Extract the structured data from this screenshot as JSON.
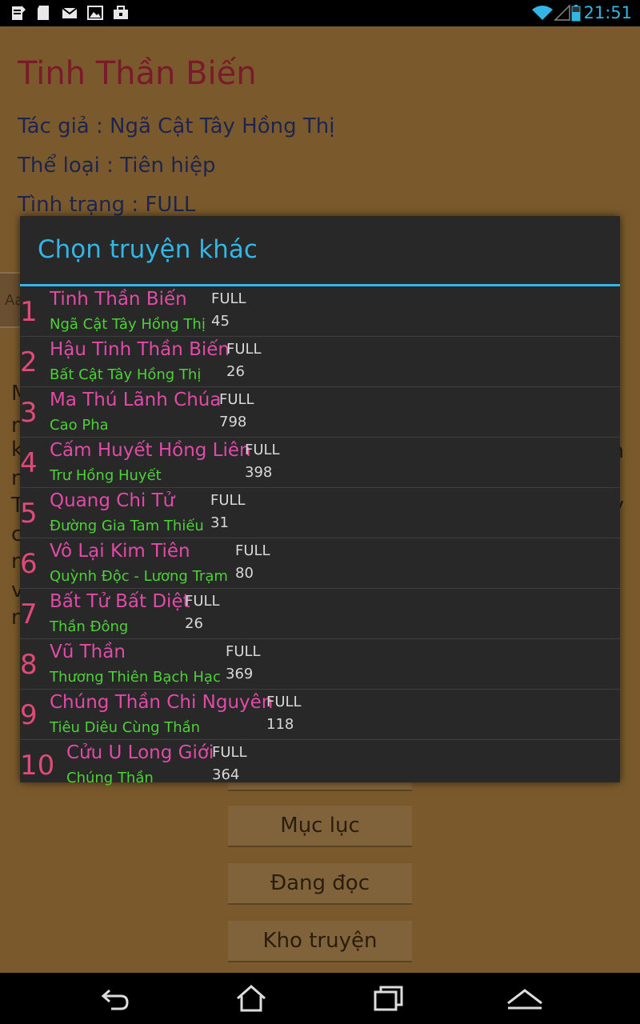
{
  "status_bar": {
    "time": "21:51",
    "icons": [
      "notes-icon",
      "sd-card-icon",
      "mail-icon",
      "image-icon",
      "briefcase-icon",
      "wifi-icon",
      "signal-icon",
      "battery-icon"
    ]
  },
  "book": {
    "title": "Tinh Thần Biến",
    "author": "Tác giả : Ngã Cật Tây Hồng Thị",
    "genre": "Thể loại : Tiên hiệp",
    "status": "Tình trạng : FULL"
  },
  "background_fragments": [
    "M",
    "n",
    "k",
    "n",
    "T",
    "c",
    "n",
    "v",
    "n"
  ],
  "background_fragments_right": [
    "n",
    "y"
  ],
  "side_badge": "Aa",
  "buttons": {
    "table_of_contents": "Mục lục",
    "reading": "Đang đọc",
    "library": "Kho truyện"
  },
  "dialog": {
    "title": "Chọn truyện khác",
    "items": [
      {
        "num": "1",
        "title": "Tinh Thần Biến",
        "author": "Ngã Cật Tây Hồng Thị",
        "status": "FULL",
        "chapters": "45"
      },
      {
        "num": "2",
        "title": "Hậu Tinh Thần Biến",
        "author": "Bất Cật Tây Hồng Thị",
        "status": "FULL",
        "chapters": "26"
      },
      {
        "num": "3",
        "title": "Ma Thú Lãnh Chúa",
        "author": "Cao Pha",
        "status": "FULL",
        "chapters": "798"
      },
      {
        "num": "4",
        "title": "Cấm Huyết Hồng Liên",
        "author": "Trư Hồng Huyết",
        "status": "FULL",
        "chapters": "398"
      },
      {
        "num": "5",
        "title": "Quang Chi Tử",
        "author": "Đường Gia Tam Thiếu",
        "status": "FULL",
        "chapters": "31"
      },
      {
        "num": "6",
        "title": "Vô Lại Kim Tiên",
        "author": "Quỳnh Độc - Lương Trạm",
        "status": "FULL",
        "chapters": "80"
      },
      {
        "num": "7",
        "title": "Bất Tử Bất Diệt",
        "author": "Thần Đông",
        "status": "FULL",
        "chapters": "26"
      },
      {
        "num": "8",
        "title": "Vũ Thần",
        "author": "Thương Thiên Bạch Hạc",
        "status": "FULL",
        "chapters": "369"
      },
      {
        "num": "9",
        "title": "Chúng Thần Chi Nguyên",
        "author": "Tiêu Diêu Cùng Thần",
        "status": "FULL",
        "chapters": "118"
      },
      {
        "num": "10",
        "title": "Cửu U Long Giới",
        "author": "Chúng Thần",
        "status": "FULL",
        "chapters": "364"
      }
    ]
  },
  "nav_bar": {
    "icons": [
      "back-icon",
      "home-icon",
      "recent-apps-icon",
      "menu-up-icon"
    ]
  },
  "colors": {
    "accent": "#33b5e5",
    "app_background": "#7a5a2c",
    "dialog_background": "#282828",
    "item_title": "#e24aa8",
    "item_author": "#4cd137",
    "item_number": "#e04a78"
  }
}
